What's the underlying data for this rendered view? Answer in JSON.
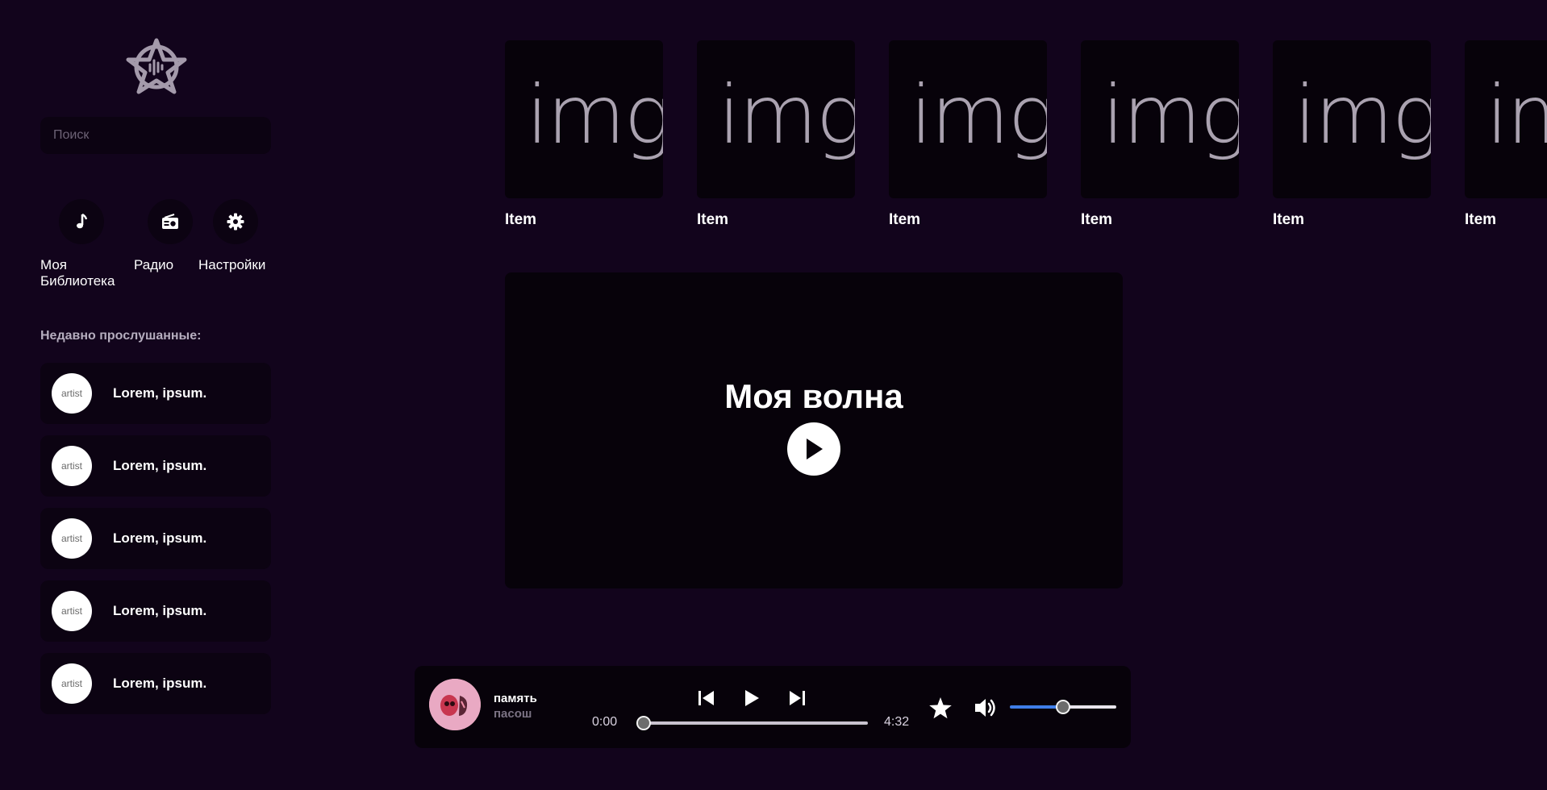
{
  "sidebar": {
    "search_placeholder": "Поиск",
    "nav": [
      {
        "label": "Моя Библиотека",
        "icon": "music-note-icon"
      },
      {
        "label": "Радио",
        "icon": "radio-icon"
      },
      {
        "label": "Настройки",
        "icon": "gear-icon"
      }
    ],
    "recent_title": "Недавно прослушанные:",
    "recent": [
      {
        "avatar": "artist",
        "label": "Lorem, ipsum."
      },
      {
        "avatar": "artist",
        "label": "Lorem, ipsum."
      },
      {
        "avatar": "artist",
        "label": "Lorem, ipsum."
      },
      {
        "avatar": "artist",
        "label": "Lorem, ipsum."
      },
      {
        "avatar": "artist",
        "label": "Lorem, ipsum."
      }
    ]
  },
  "carousel": [
    {
      "cover": "img",
      "label": "Item"
    },
    {
      "cover": "img",
      "label": "Item"
    },
    {
      "cover": "img",
      "label": "Item"
    },
    {
      "cover": "img",
      "label": "Item"
    },
    {
      "cover": "img",
      "label": "Item"
    },
    {
      "cover": "img",
      "label": "Item"
    }
  ],
  "wave": {
    "title": "Моя волна"
  },
  "player": {
    "title": "память",
    "artist": "пасош",
    "current_time": "0:00",
    "duration": "4:32",
    "progress": 0,
    "volume": 0.5
  },
  "colors": {
    "background": "#12041c",
    "card": "#0c0312",
    "accent_blue": "#3f7ee8"
  }
}
